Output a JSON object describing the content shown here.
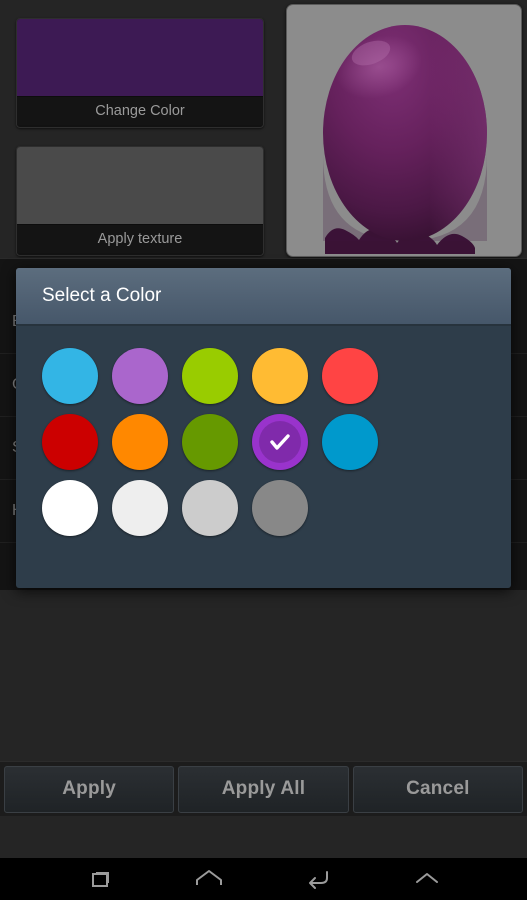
{
  "screen": {
    "background_color": "#252525"
  },
  "editor": {
    "tiles": [
      {
        "name": "change-color",
        "label": "Change Color",
        "swatch_color": "#3d1a54"
      },
      {
        "name": "apply-texture",
        "label": "Apply texture",
        "swatch_color": "#4a4a4a"
      }
    ],
    "preview": {
      "panel_color": "#8c8c8c",
      "object_name": "egg-shape",
      "object_color": "#5e1f57",
      "object_highlight": "#7d2f72",
      "object_shadow": "#2d0e2c"
    },
    "list_items": [
      {
        "label": "B"
      },
      {
        "label": "C"
      },
      {
        "label": "S"
      },
      {
        "label": "H"
      }
    ]
  },
  "dialog": {
    "title": "Select a Color",
    "title_bar_color": "#4f6074",
    "body_color": "#2e3d4a",
    "selected_index": {
      "row": 1,
      "col": 3
    },
    "check_icon": "check-icon",
    "rows": [
      [
        {
          "name": "swatch-sky-blue",
          "color": "#33b5e5",
          "selected": false
        },
        {
          "name": "swatch-light-purple",
          "color": "#aa66cc",
          "selected": false
        },
        {
          "name": "swatch-lime-green",
          "color": "#99cc00",
          "selected": false
        },
        {
          "name": "swatch-amber",
          "color": "#ffbb33",
          "selected": false
        },
        {
          "name": "swatch-coral-red",
          "color": "#ff4444",
          "selected": false
        }
      ],
      [
        {
          "name": "swatch-crimson",
          "color": "#cc0000",
          "selected": false
        },
        {
          "name": "swatch-orange",
          "color": "#ff8800",
          "selected": false
        },
        {
          "name": "swatch-olive-green",
          "color": "#669900",
          "selected": false
        },
        {
          "name": "swatch-purple",
          "color": "#9933cc",
          "selected": true
        },
        {
          "name": "swatch-dark-cyan",
          "color": "#0099cc",
          "selected": false
        }
      ],
      [
        {
          "name": "swatch-white",
          "color": "#ffffff",
          "selected": false
        },
        {
          "name": "swatch-off-white",
          "color": "#eeeeee",
          "selected": false
        },
        {
          "name": "swatch-light-gray",
          "color": "#cccccc",
          "selected": false
        },
        {
          "name": "swatch-gray",
          "color": "#888888",
          "selected": false
        }
      ]
    ]
  },
  "action_bar": {
    "buttons": [
      {
        "name": "apply-button",
        "label": "Apply"
      },
      {
        "name": "apply-all-button",
        "label": "Apply All"
      },
      {
        "name": "cancel-button",
        "label": "Cancel"
      }
    ]
  },
  "navbar": {
    "buttons": [
      {
        "name": "recents-icon",
        "label": "recents"
      },
      {
        "name": "home-icon",
        "label": "home"
      },
      {
        "name": "back-icon",
        "label": "back"
      },
      {
        "name": "chevron-up-icon",
        "label": "expand"
      }
    ]
  }
}
